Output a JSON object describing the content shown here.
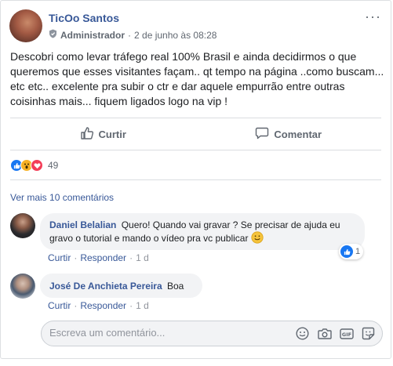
{
  "post": {
    "author": "TicOo Santos",
    "role": "Administrador",
    "separator": "·",
    "date": "2 de junho às 08:28",
    "text": "Descobri como levar tráfego real 100% Brasil e ainda decidirmos o que queremos que esses visitantes façam.. qt tempo na página ..como buscam... etc etc.. excelente pra subir o ctr e dar aquele empurrão entre outras coisinhas mais... fiquem ligados logo na vip !",
    "menu_label": "···"
  },
  "actions": {
    "like_label": "Curtir",
    "comment_label": "Comentar"
  },
  "reactions": {
    "count": "49",
    "types": [
      "like-icon",
      "wow-icon",
      "love-icon"
    ]
  },
  "view_more_label": "Ver mais 10 comentários",
  "comments": [
    {
      "author": "Daniel Belalian",
      "text": "Quero! Quando vai gravar ? Se precisar de ajuda eu gravo o tutorial e mando o vídeo pra vc publicar",
      "emoji": "🙂",
      "like_label": "Curtir",
      "reply_label": "Responder",
      "time": "1 d",
      "reaction_count": "1"
    },
    {
      "author": "José De Anchieta Pereira",
      "text": "Boa",
      "like_label": "Curtir",
      "reply_label": "Responder",
      "time": "1 d"
    }
  ],
  "composer": {
    "placeholder": "Escreva um comentário...",
    "icons": [
      "emoji-icon",
      "camera-icon",
      "gif-icon",
      "sticker-icon"
    ]
  },
  "colors": {
    "link": "#385898",
    "like_blue": "#1877f2",
    "wow_yellow": "#f7b125",
    "love_red": "#f33e58",
    "muted": "#606770"
  }
}
